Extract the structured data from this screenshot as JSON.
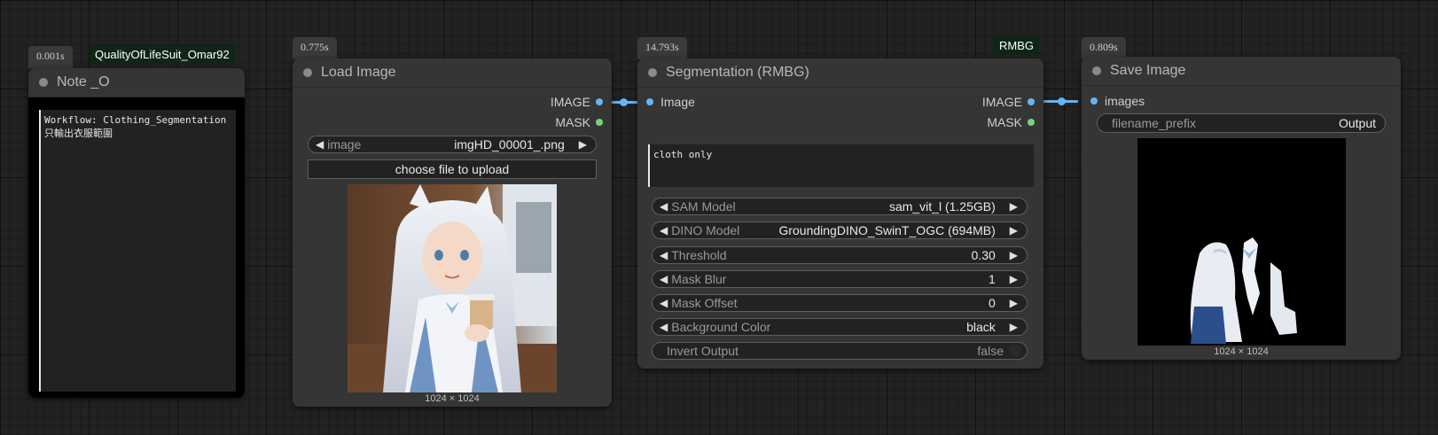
{
  "nodes": {
    "note": {
      "time": "0.001s",
      "tag": "QualityOfLifeSuit_Omar92",
      "title": "Note _O",
      "text": "Workflow: Clothing_Segmentation\n只輸出衣服範圍"
    },
    "load_image": {
      "time": "0.775s",
      "title": "Load Image",
      "outputs": [
        "IMAGE",
        "MASK"
      ],
      "image_widget": {
        "label": "image",
        "value": "imgHD_00001_.png"
      },
      "upload_button": "choose file to upload",
      "dims": "1024 × 1024"
    },
    "segmentation": {
      "time": "14.793s",
      "tag": "RMBG",
      "title": "Segmentation (RMBG)",
      "input": "Image",
      "outputs": [
        "IMAGE",
        "MASK"
      ],
      "prompt": "cloth only",
      "widgets": [
        {
          "label": "SAM Model",
          "value": "sam_vit_l (1.25GB)"
        },
        {
          "label": "DINO Model",
          "value": "GroundingDINO_SwinT_OGC (694MB)"
        },
        {
          "label": "Threshold",
          "value": "0.30"
        },
        {
          "label": "Mask Blur",
          "value": "1"
        },
        {
          "label": "Mask Offset",
          "value": "0"
        },
        {
          "label": "Background Color",
          "value": "black"
        }
      ],
      "toggle": {
        "label": "Invert Output",
        "value": "false"
      }
    },
    "save_image": {
      "time": "0.809s",
      "title": "Save Image",
      "input": "images",
      "prefix": {
        "label": "filename_prefix",
        "value": "Output"
      },
      "dims": "1024 × 1024"
    }
  },
  "colors": {
    "link": "#64b5f6",
    "mask_slot": "#7bd17b",
    "canvas": "#222222",
    "node": "#353535"
  }
}
